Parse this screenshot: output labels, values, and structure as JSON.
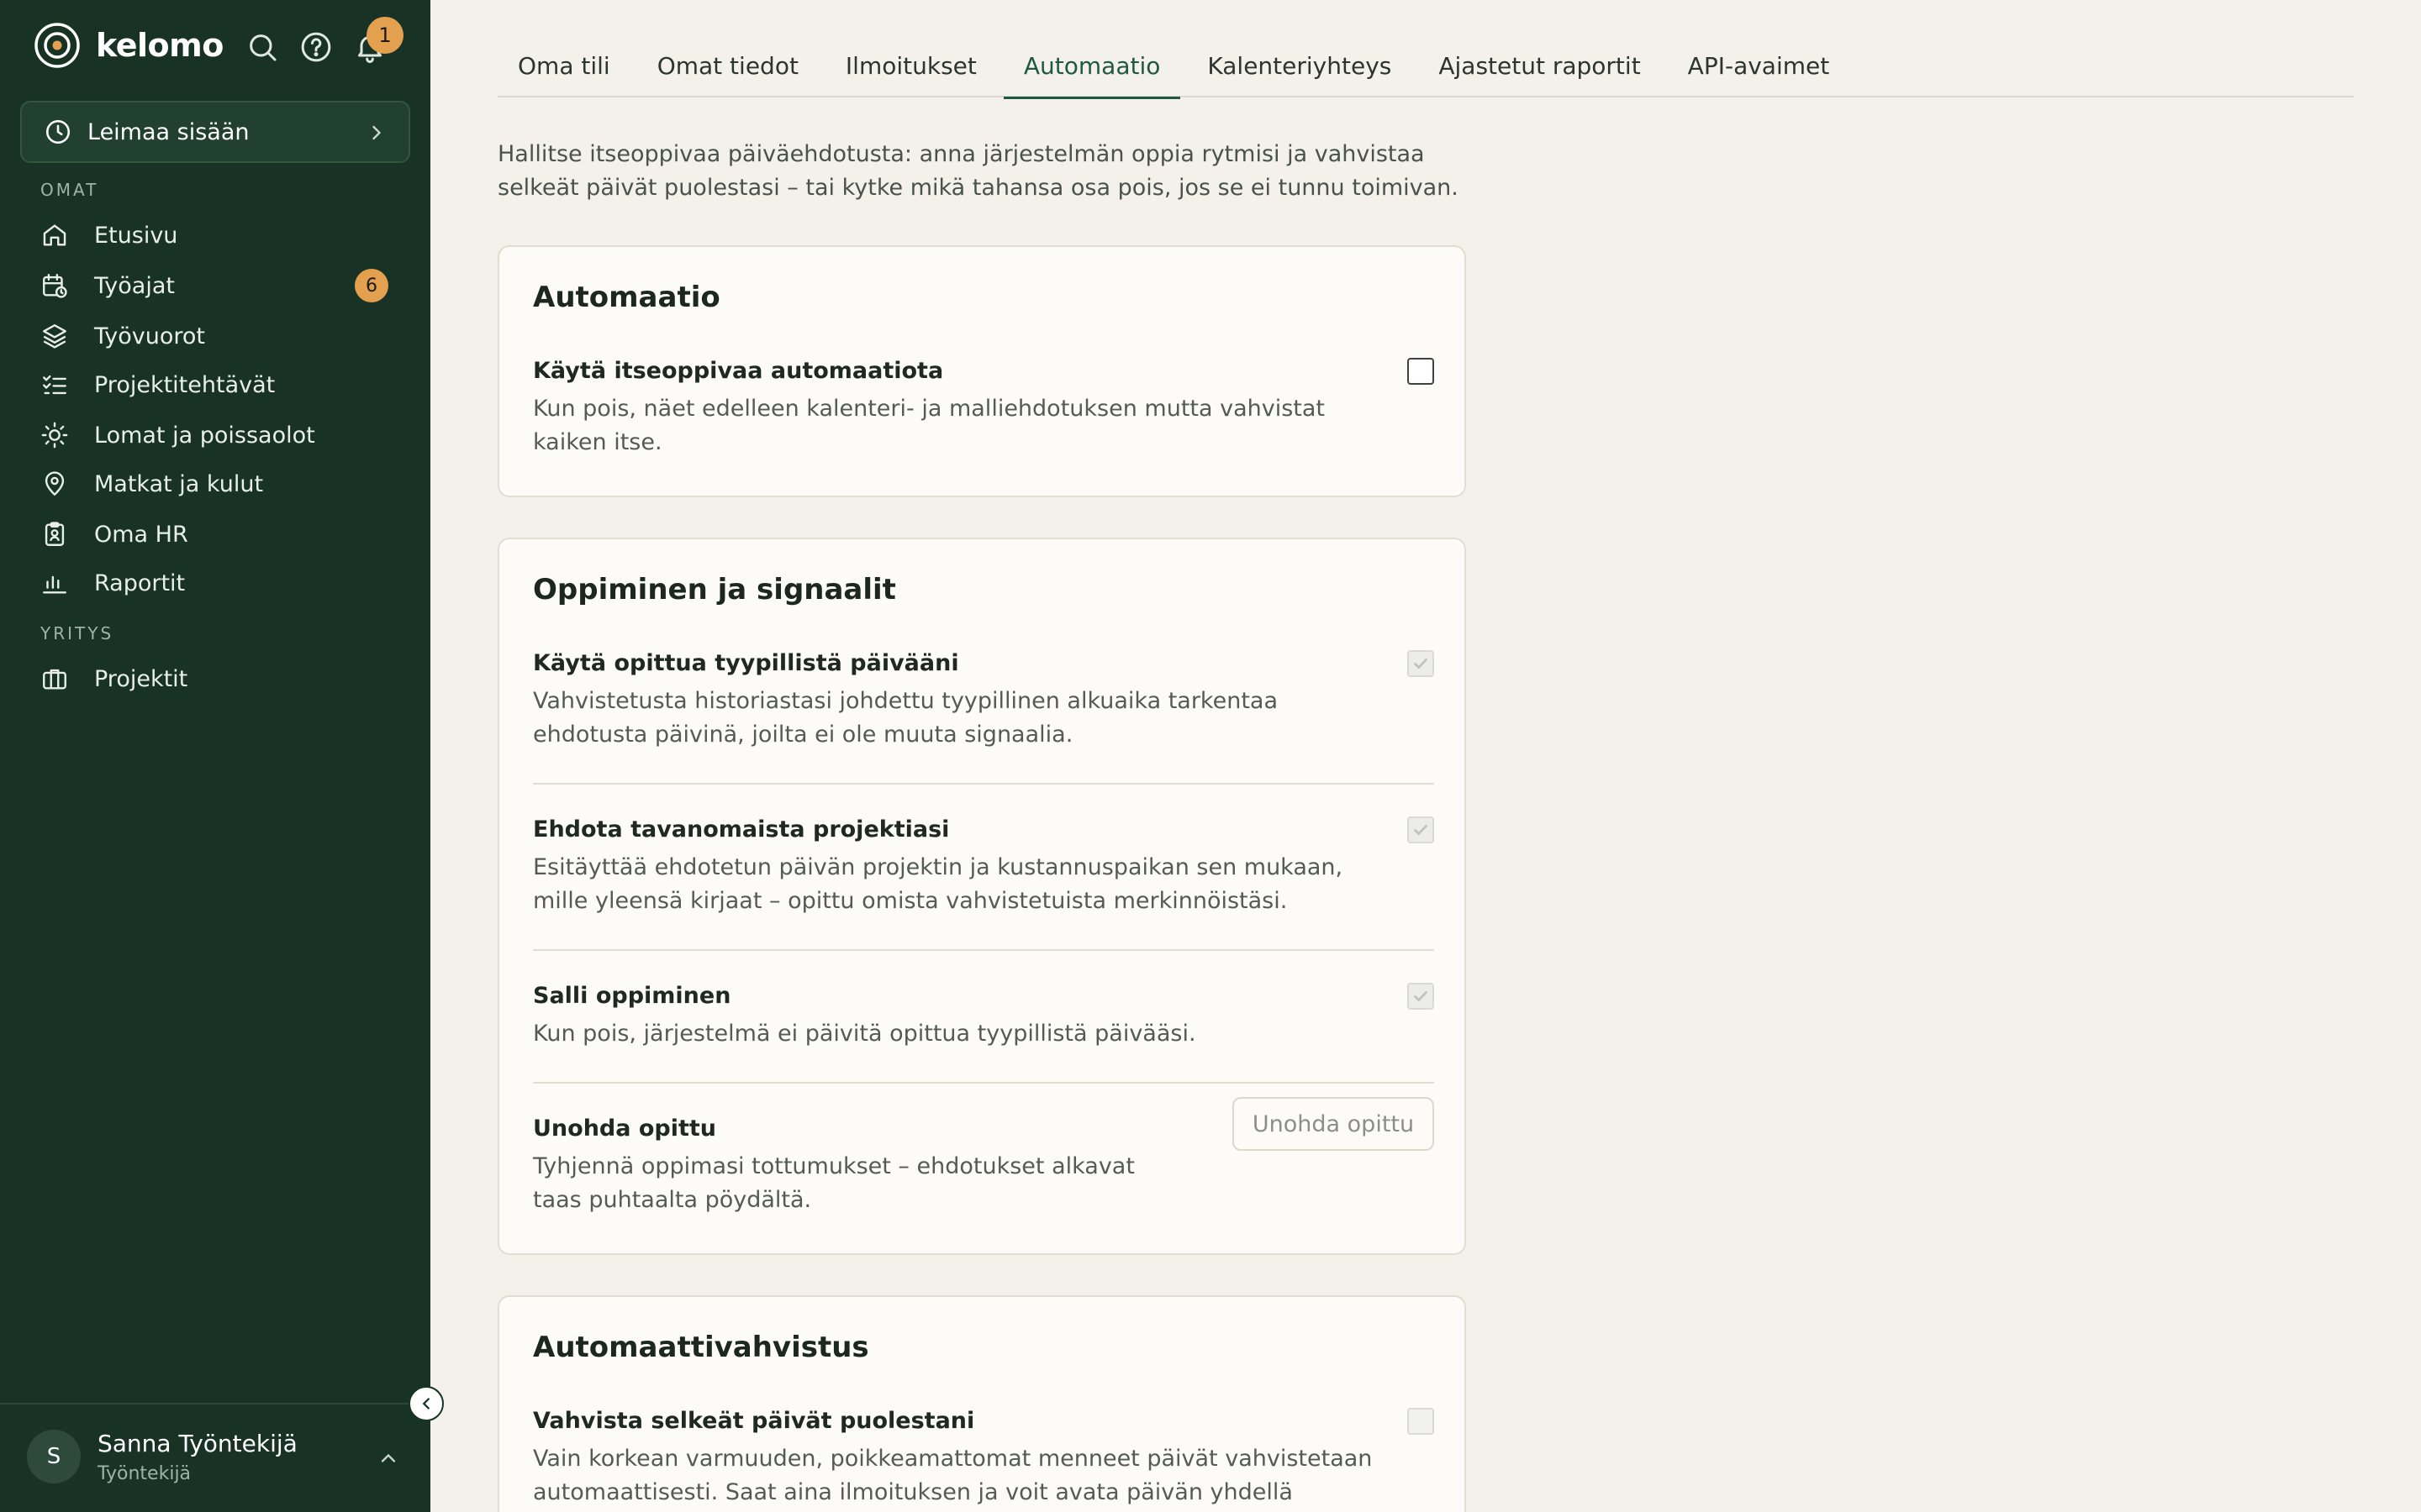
{
  "brand": {
    "name": "kelomo",
    "notification_count": "1"
  },
  "clock_in": {
    "label": "Leimaa sisään"
  },
  "sidebar": {
    "section_own": "OMAT",
    "items": [
      {
        "label": "Etusivu",
        "icon": "home-icon"
      },
      {
        "label": "Työajat",
        "icon": "calendar-clock-icon",
        "badge": "6"
      },
      {
        "label": "Työvuorot",
        "icon": "layers-icon"
      },
      {
        "label": "Projektitehtävät",
        "icon": "checklist-icon"
      },
      {
        "label": "Lomat ja poissaolot",
        "icon": "sun-icon"
      },
      {
        "label": "Matkat ja kulut",
        "icon": "map-pin-icon"
      },
      {
        "label": "Oma HR",
        "icon": "clipboard-user-icon"
      },
      {
        "label": "Raportit",
        "icon": "bar-chart-icon"
      }
    ],
    "section_company": "YRITYS",
    "company_items": [
      {
        "label": "Projektit",
        "icon": "briefcase-icon"
      }
    ]
  },
  "user": {
    "initial": "S",
    "name": "Sanna Työntekijä",
    "role": "Työntekijä"
  },
  "tabs": [
    {
      "label": "Oma tili"
    },
    {
      "label": "Omat tiedot"
    },
    {
      "label": "Ilmoitukset"
    },
    {
      "label": "Automaatio",
      "active": true
    },
    {
      "label": "Kalenteriyhteys"
    },
    {
      "label": "Ajastetut raportit"
    },
    {
      "label": "API-avaimet"
    }
  ],
  "intro": "Hallitse itseoppivaa päiväehdotusta: anna järjestelmän oppia rytmisi ja vahvistaa selkeät päivät puolestasi – tai kytke mikä tahansa osa pois, jos se ei tunnu toimivan.",
  "cards": {
    "automation": {
      "title": "Automaatio",
      "settings": [
        {
          "title": "Käytä itseoppivaa automaatiota",
          "desc": "Kun pois, näet edelleen kalenteri- ja malliehdotuksen mutta vahvistat kaiken itse.",
          "checked": false
        }
      ]
    },
    "learning": {
      "title": "Oppiminen ja signaalit",
      "settings": [
        {
          "title": "Käytä opittua tyypillistä päivääni",
          "desc": "Vahvistetusta historiastasi johdettu tyypillinen alkuaika tarkentaa ehdotusta päivinä, joilta ei ole muuta signaalia.",
          "checked": true
        },
        {
          "title": "Ehdota tavanomaista projektiasi",
          "desc": "Esitäyttää ehdotetun päivän projektin ja kustannuspaikan sen mukaan, mille yleensä kirjaat – opittu omista vahvistetuista merkinnöistäsi.",
          "checked": true
        },
        {
          "title": "Salli oppiminen",
          "desc": "Kun pois, järjestelmä ei päivitä opittua tyypillistä päivääsi.",
          "checked": true
        },
        {
          "title": "Unohda opittu",
          "desc": "Tyhjennä oppimasi tottumukset – ehdotukset alkavat taas puhtaalta pöydältä.",
          "button": "Unohda opittu"
        }
      ]
    },
    "auto_confirm": {
      "title": "Automaattivahvistus",
      "settings": [
        {
          "title": "Vahvista selkeät päivät puolestani",
          "desc": "Vain korkean varmuuden, poikkeamattomat menneet päivät vahvistetaan automaattisesti. Saat aina ilmoituksen ja voit avata päivän yhdellä",
          "checked": false
        }
      ]
    }
  }
}
